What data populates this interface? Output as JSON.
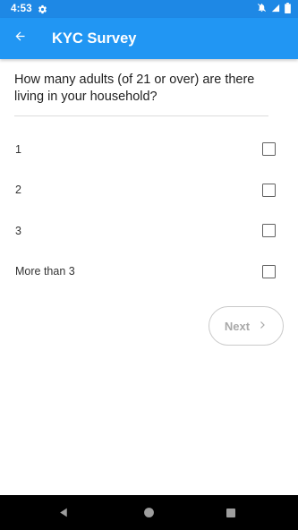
{
  "status_bar": {
    "time": "4:53",
    "icons": [
      "settings-gear-icon",
      "notifications-off-icon",
      "signal-icon",
      "battery-icon"
    ]
  },
  "app_bar": {
    "title": "KYC Survey",
    "back_icon": "arrow-back-icon",
    "color": "#2196f3"
  },
  "question": {
    "text": "How many adults (of 21 or over) are there living in your household?"
  },
  "options": [
    {
      "label": "1",
      "checked": false
    },
    {
      "label": "2",
      "checked": false
    },
    {
      "label": "3",
      "checked": false
    },
    {
      "label": "More than 3",
      "checked": false
    }
  ],
  "next_button": {
    "label": "Next",
    "icon": "chevron-right-icon",
    "enabled": false
  },
  "nav_bar": {
    "buttons": [
      "back-triangle-icon",
      "home-circle-icon",
      "recents-square-icon"
    ]
  }
}
